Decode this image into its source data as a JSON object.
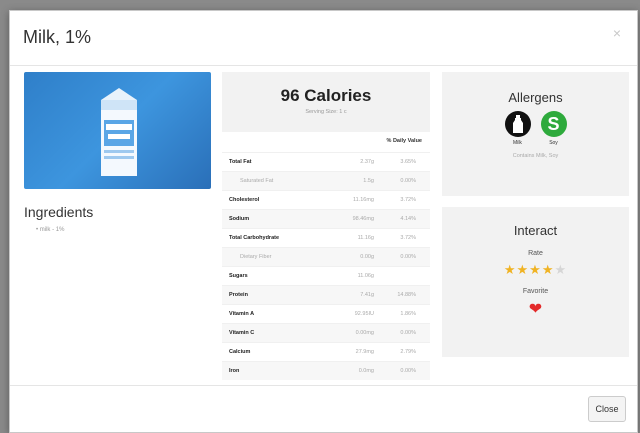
{
  "modal": {
    "title": "Milk, 1%",
    "close_icon": "×",
    "close_button_label": "Close"
  },
  "ingredients": {
    "title": "Ingredients",
    "items": [
      "• milk - 1%"
    ]
  },
  "nutrition": {
    "calories": "96 Calories",
    "serving": "Serving Size: 1 c",
    "dv_header": "% Daily Value",
    "rows": [
      {
        "label": "Total Fat",
        "amount": "2.37g",
        "pct": "3.65%"
      },
      {
        "label": "Saturated Fat",
        "amount": "1.5g",
        "pct": "0.00%"
      },
      {
        "label": "Cholesterol",
        "amount": "11.16mg",
        "pct": "3.72%"
      },
      {
        "label": "Sodium",
        "amount": "98.46mg",
        "pct": "4.14%"
      },
      {
        "label": "Total Carbohydrate",
        "amount": "11.16g",
        "pct": "3.72%"
      },
      {
        "label": "Dietary Fiber",
        "amount": "0.00g",
        "pct": "0.00%"
      },
      {
        "label": "Sugars",
        "amount": "11.06g",
        "pct": ""
      },
      {
        "label": "Protein",
        "amount": "7.41g",
        "pct": "14.88%"
      },
      {
        "label": "Vitamin A",
        "amount": "92.95IU",
        "pct": "1.86%"
      },
      {
        "label": "Vitamin C",
        "amount": "0.00mg",
        "pct": "0.00%"
      },
      {
        "label": "Calcium",
        "amount": "27.9mg",
        "pct": "2.79%"
      },
      {
        "label": "Iron",
        "amount": "0.0mg",
        "pct": "0.00%"
      }
    ]
  },
  "allergens": {
    "title": "Allergens",
    "items": [
      {
        "name": "Milk",
        "icon": "milk-bottle-icon"
      },
      {
        "name": "Soy",
        "icon": "soy-icon",
        "glyph": "S"
      }
    ],
    "contains": "Contains Milk, Soy"
  },
  "interact": {
    "title": "Interact",
    "rate_label": "Rate",
    "rating": 4,
    "rating_max": 5,
    "favorite_label": "Favorite",
    "favorited": true
  },
  "colors": {
    "accent_star": "#f0b323",
    "heart": "#e32a2a",
    "soy_green": "#2eaa3c",
    "image_blue": "#3d95de"
  }
}
